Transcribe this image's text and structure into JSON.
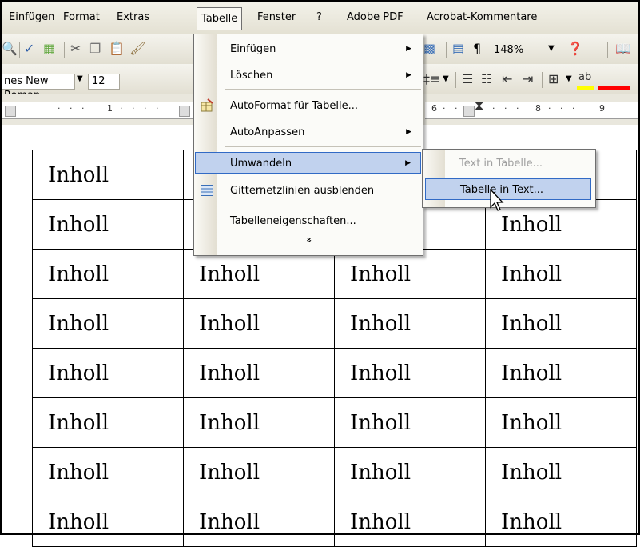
{
  "menubar": {
    "items": [
      "Einfügen",
      "Format",
      "Extras",
      "Tabelle",
      "Fenster",
      "?",
      "Adobe PDF",
      "Acrobat-Kommentare"
    ],
    "active": "Tabelle"
  },
  "toolbar": {
    "zoom": "148%",
    "font_name": "nes New Roman",
    "font_size": "12",
    "ruler_left_digits": [
      "1"
    ],
    "ruler_right_digits": [
      "6",
      "8",
      "9"
    ]
  },
  "table_menu": {
    "items": [
      {
        "label": "Einfügen",
        "submenu": true
      },
      {
        "label": "Löschen",
        "submenu": true
      },
      {
        "label": "AutoFormat für Tabelle...",
        "submenu": false
      },
      {
        "label": "AutoAnpassen",
        "submenu": true
      },
      {
        "label": "Umwandeln",
        "submenu": true,
        "highlighted": true
      },
      {
        "label": "Gitternetzlinien ausblenden",
        "submenu": false
      },
      {
        "label": "Tabelleneigenschaften...",
        "submenu": false
      }
    ],
    "expand_glyph": "»"
  },
  "convert_submenu": {
    "items": [
      {
        "label": "Text in Tabelle...",
        "disabled": true
      },
      {
        "label": "Tabelle in Text...",
        "highlighted": true
      }
    ]
  },
  "document": {
    "cell_text": "Inholl",
    "rows": 8,
    "cols": 4
  },
  "colors": {
    "menu_highlight": "#c1d2ee",
    "menu_highlight_border": "#316ac5"
  }
}
